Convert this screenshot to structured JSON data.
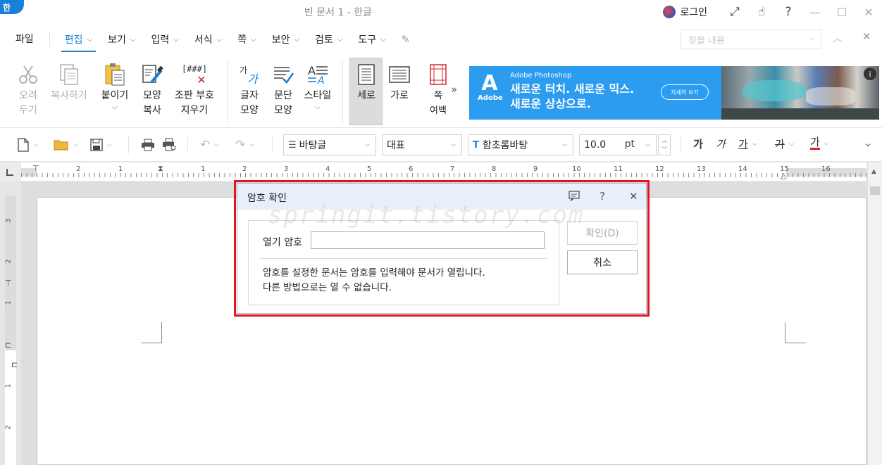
{
  "titlebar": {
    "app_badge": "한",
    "title": "빈 문서 1 - 한글",
    "login_label": "로그인",
    "icons": [
      "expand-icon",
      "touch-hand-icon",
      "help-icon",
      "minimize-icon",
      "maximize-icon",
      "close-icon"
    ]
  },
  "menubar": {
    "file": "파일",
    "items": [
      "편집",
      "보기",
      "입력",
      "서식",
      "쪽",
      "보안",
      "검토",
      "도구"
    ],
    "active": "편집",
    "find_placeholder": "찾을 내용"
  },
  "ribbon": {
    "cut": "오려\n두기",
    "copy": "복사하기",
    "paste": "붙이기",
    "format_copy": "모양\n복사",
    "clear_codes": "조판 부호\n지우기",
    "clear_codes_glyph": "[###]",
    "char_shape": "글자\n모양",
    "para_shape": "문단\n모양",
    "style": "스타일",
    "portrait": "세로",
    "landscape": "가로",
    "page_margin": "쪽\n여백"
  },
  "ad": {
    "brand": "Adobe",
    "product": "Adobe Photoshop",
    "headline1": "새로운 터치. 새로운 믹스.",
    "headline2": "새로운 상상으로.",
    "cta": "자세히 보기",
    "info": "i"
  },
  "toolbar2": {
    "style_value": "바탕글",
    "lang_value": "대표",
    "font_value": "함초롬바탕",
    "size_value": "10.0",
    "size_unit": "pt",
    "bold_glyph": "가",
    "italic_glyph": "가",
    "underline_glyph": "가",
    "strike_glyph": "가",
    "color_glyph": "가"
  },
  "ruler": {
    "numbers": [
      "2",
      "1",
      "1",
      "2",
      "3",
      "4",
      "5",
      "6",
      "7",
      "8",
      "9",
      "10",
      "11",
      "12",
      "13",
      "14",
      "15",
      "16"
    ],
    "vnumbers": [
      "3",
      "2",
      "1",
      "1",
      "2"
    ]
  },
  "dialog": {
    "title": "암호 확인",
    "password_label": "열기 암호",
    "password_value": "",
    "message_line1": "암호를 설정한 문서는 암호를 입력해야 문서가 열립니다.",
    "message_line2": "다른 방법으로는 열 수 없습니다.",
    "ok_label": "확인(D)",
    "cancel_label": "취소"
  },
  "watermark": "springit.tistory.com",
  "colors": {
    "accent": "#1a7fd6",
    "highlight_border": "#e4141b",
    "dialog_title_bg": "#e6effa",
    "ad_bg": "#2c9cf0"
  }
}
